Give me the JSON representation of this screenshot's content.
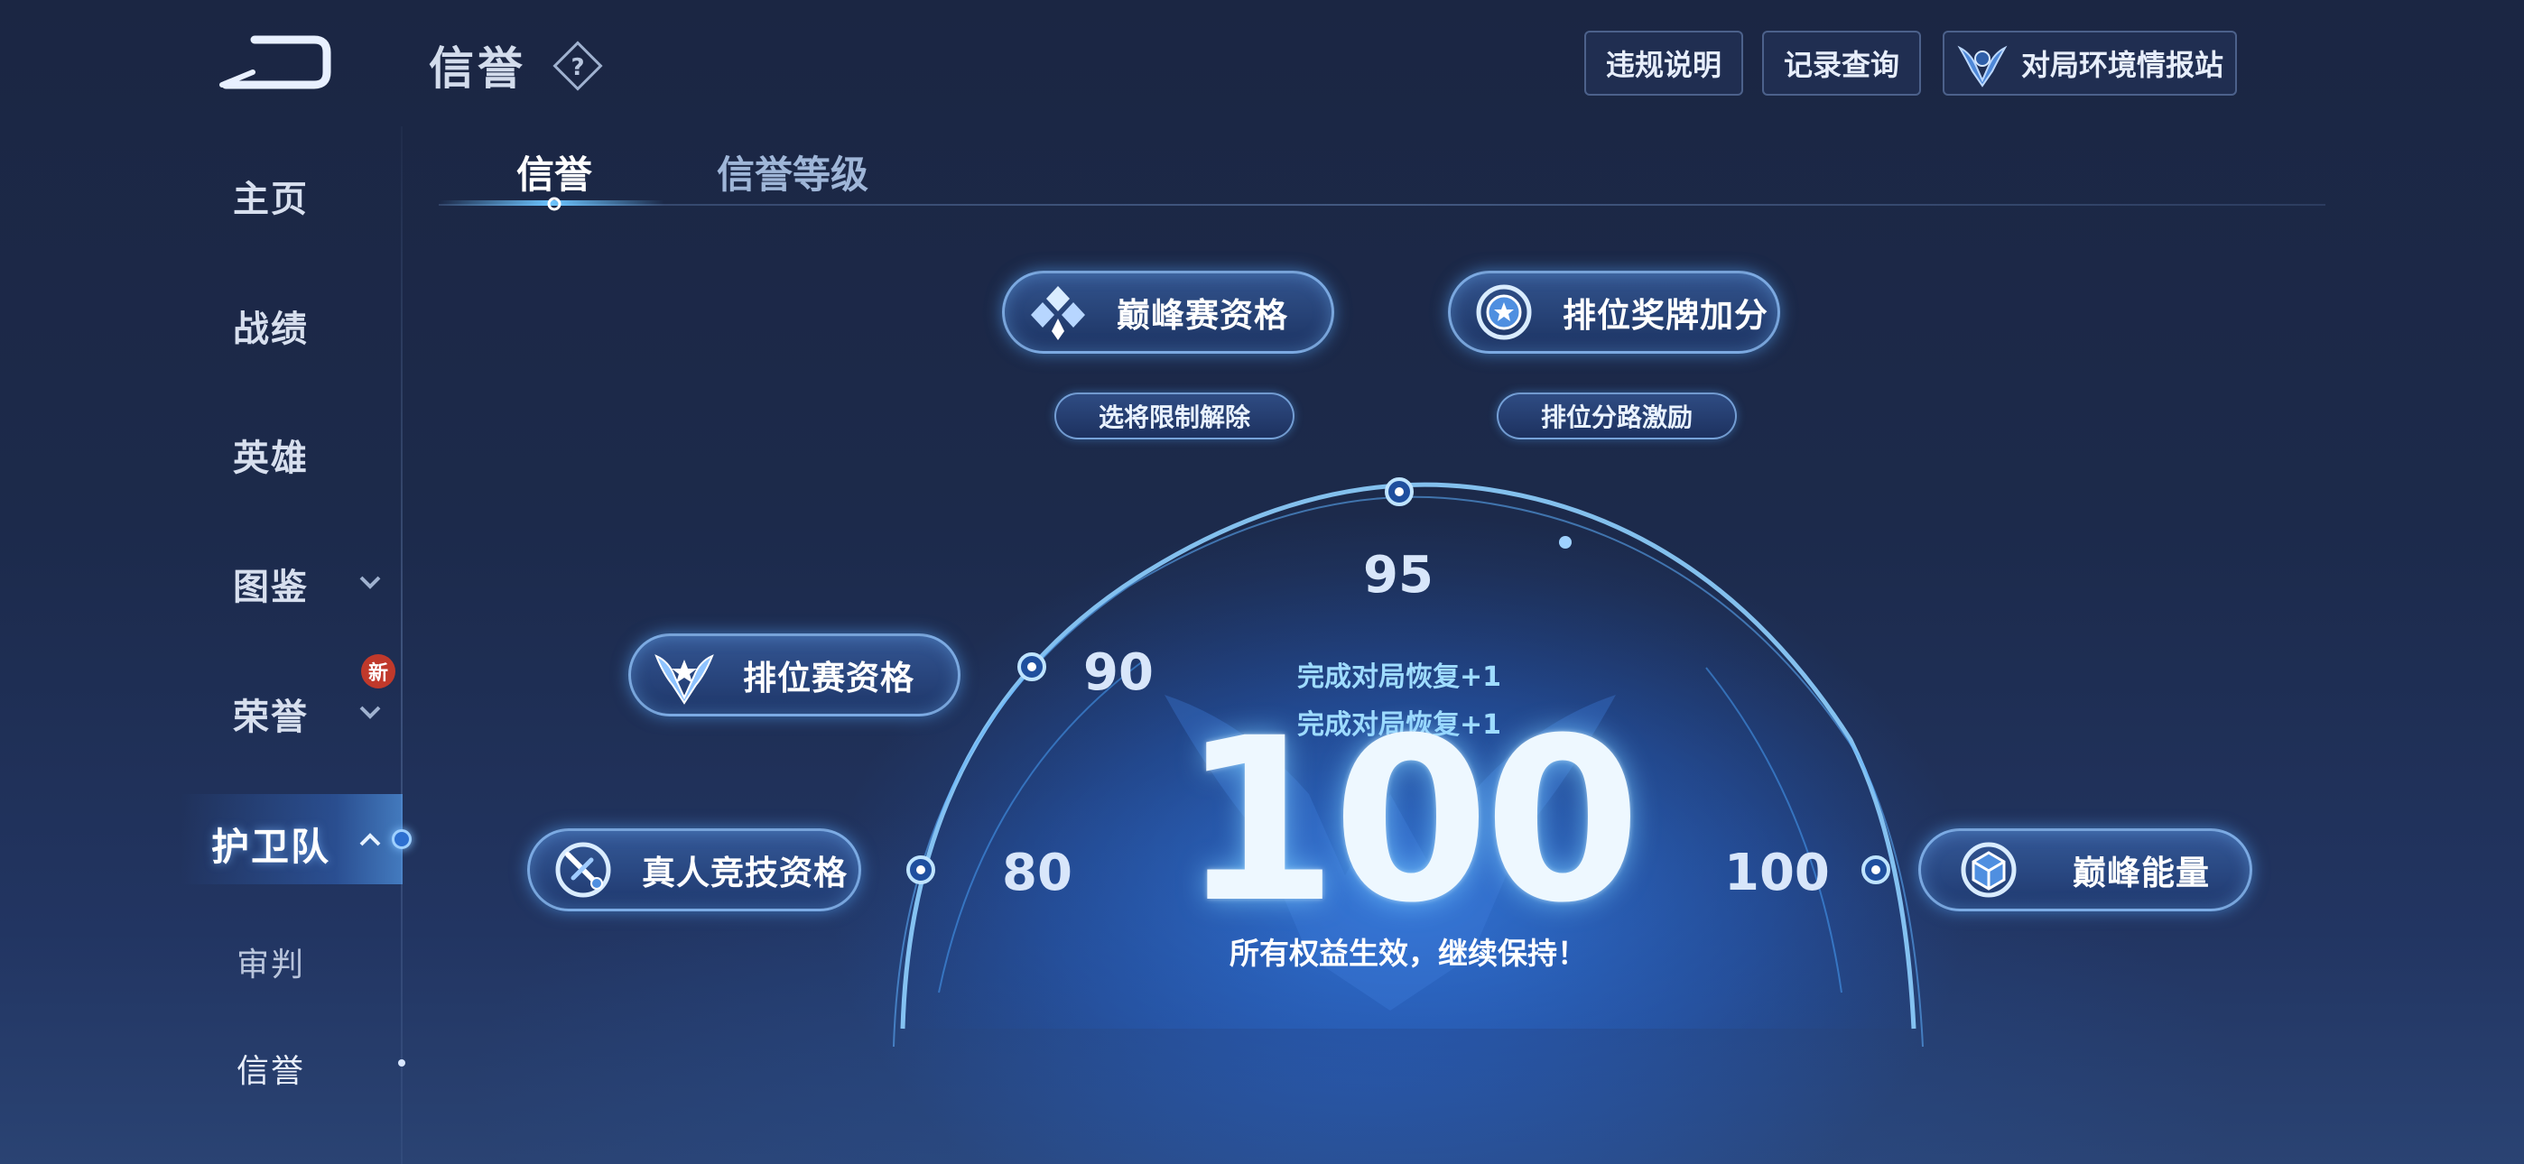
{
  "header": {
    "title": "信誉",
    "buttons": {
      "violation": "违规说明",
      "records": "记录查询",
      "environment": "对局环境情报站"
    }
  },
  "sidebar": {
    "items": [
      {
        "label": "主页"
      },
      {
        "label": "战绩"
      },
      {
        "label": "英雄"
      },
      {
        "label": "图鉴"
      },
      {
        "label": "荣誉"
      },
      {
        "label": "护卫队"
      },
      {
        "label": "审判"
      },
      {
        "label": "信誉"
      }
    ],
    "new_badge": "新"
  },
  "tabs": [
    {
      "label": "信誉",
      "active": true
    },
    {
      "label": "信誉等级",
      "active": false
    }
  ],
  "benefits": {
    "peak_qualification": "巅峰赛资格",
    "rank_medal_bonus": "排位奖牌加分",
    "pick_restriction_lift": "选将限制解除",
    "rank_lane_incentive": "排位分路激励",
    "ranked_qualification": "排位赛资格",
    "real_player_qualification": "真人竞技资格",
    "peak_energy": "巅峰能量"
  },
  "thresholds": {
    "t80": "80",
    "t90": "90",
    "t95": "95",
    "t100": "100"
  },
  "score": {
    "value": "100",
    "recover_line1": "完成对局恢复+1",
    "recover_line2": "完成对局恢复+1",
    "status": "所有权益生效，继续保持！"
  },
  "colors": {
    "accent": "#6cc4ff",
    "badge": "#c0392b",
    "background": "#1c2a4b"
  }
}
